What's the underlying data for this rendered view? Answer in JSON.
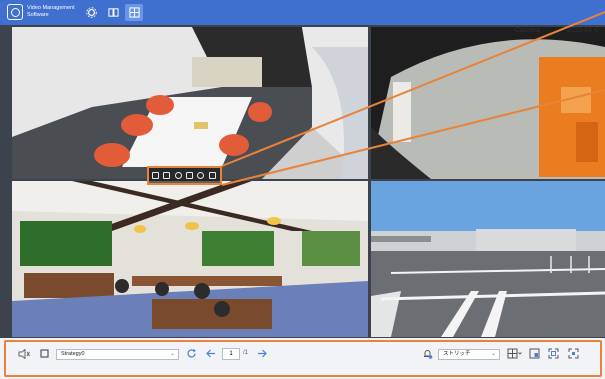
{
  "app": {
    "title": "Video Management Software"
  },
  "camera": {
    "name": "Camera",
    "timestamp": "2020-01-0"
  },
  "bottom": {
    "strategy": "Strategy0",
    "page": "1",
    "page_total": "/1",
    "stream": "ストリッチ"
  },
  "colors": {
    "topbar": "#3f6fcf",
    "highlight": "#e9823a",
    "viewbg": "#3d434d"
  },
  "icons": [
    "app-logo-icon",
    "settings-icon",
    "preview-grid-icon",
    "live-view-icon",
    "speaker-icon",
    "stop-icon",
    "refresh-icon",
    "prev-page-icon",
    "next-page-icon",
    "alarm-icon",
    "layout-grid-icon",
    "split-icon",
    "fullscreen-icon",
    "fit-icon"
  ]
}
